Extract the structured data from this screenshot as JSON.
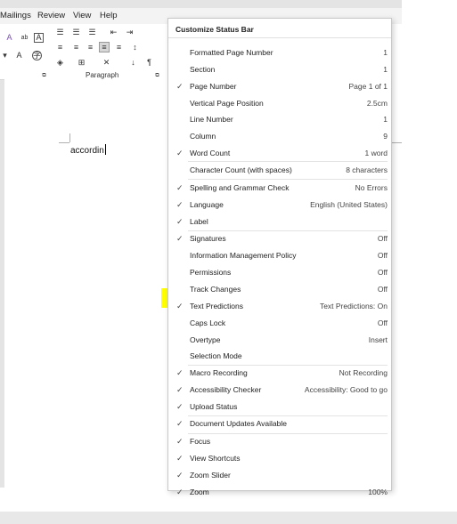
{
  "ribbon": {
    "tabs": [
      "Mailings",
      "Review",
      "View",
      "Help"
    ],
    "group_label": "Paragraph"
  },
  "document": {
    "text": "accordin"
  },
  "menu": {
    "title": "Customize Status Bar",
    "items": [
      {
        "label": "Formatted Page Number",
        "value": "1",
        "checked": false
      },
      {
        "label": "Section",
        "value": "1",
        "checked": false
      },
      {
        "label": "Page Number",
        "value": "Page 1 of 1",
        "checked": true
      },
      {
        "label": "Vertical Page Position",
        "value": "2.5cm",
        "checked": false
      },
      {
        "label": "Line Number",
        "value": "1",
        "checked": false
      },
      {
        "label": "Column",
        "value": "9",
        "checked": false
      },
      {
        "label": "Word Count",
        "value": "1 word",
        "checked": true
      },
      {
        "label": "Character Count (with spaces)",
        "value": "8 characters",
        "checked": false
      },
      {
        "label": "Spelling and Grammar Check",
        "value": "No Errors",
        "checked": true
      },
      {
        "label": "Language",
        "value": "English (United States)",
        "checked": true
      },
      {
        "label": "Label",
        "value": "",
        "checked": true
      },
      {
        "label": "Signatures",
        "value": "Off",
        "checked": true
      },
      {
        "label": "Information Management Policy",
        "value": "Off",
        "checked": false
      },
      {
        "label": "Permissions",
        "value": "Off",
        "checked": false
      },
      {
        "label": "Track Changes",
        "value": "Off",
        "checked": false
      },
      {
        "label": "Text Predictions",
        "value": "Text Predictions: On",
        "checked": true
      },
      {
        "label": "Caps Lock",
        "value": "Off",
        "checked": false
      },
      {
        "label": "Overtype",
        "value": "Insert",
        "checked": false
      },
      {
        "label": "Selection Mode",
        "value": "",
        "checked": false
      },
      {
        "label": "Macro Recording",
        "value": "Not Recording",
        "checked": true
      },
      {
        "label": "Accessibility Checker",
        "value": "Accessibility: Good to go",
        "checked": true
      },
      {
        "label": "Upload Status",
        "value": "",
        "checked": true
      },
      {
        "label": "Document Updates Available",
        "value": "",
        "checked": true
      },
      {
        "label": "Focus",
        "value": "",
        "checked": true
      },
      {
        "label": "View Shortcuts",
        "value": "",
        "checked": true
      },
      {
        "label": "Zoom Slider",
        "value": "",
        "checked": true
      },
      {
        "label": "Zoom",
        "value": "100%",
        "checked": true
      }
    ],
    "check_glyph": "✓"
  },
  "colors": {
    "highlight": "#ffff00",
    "menu_border": "#c8c8c8"
  }
}
